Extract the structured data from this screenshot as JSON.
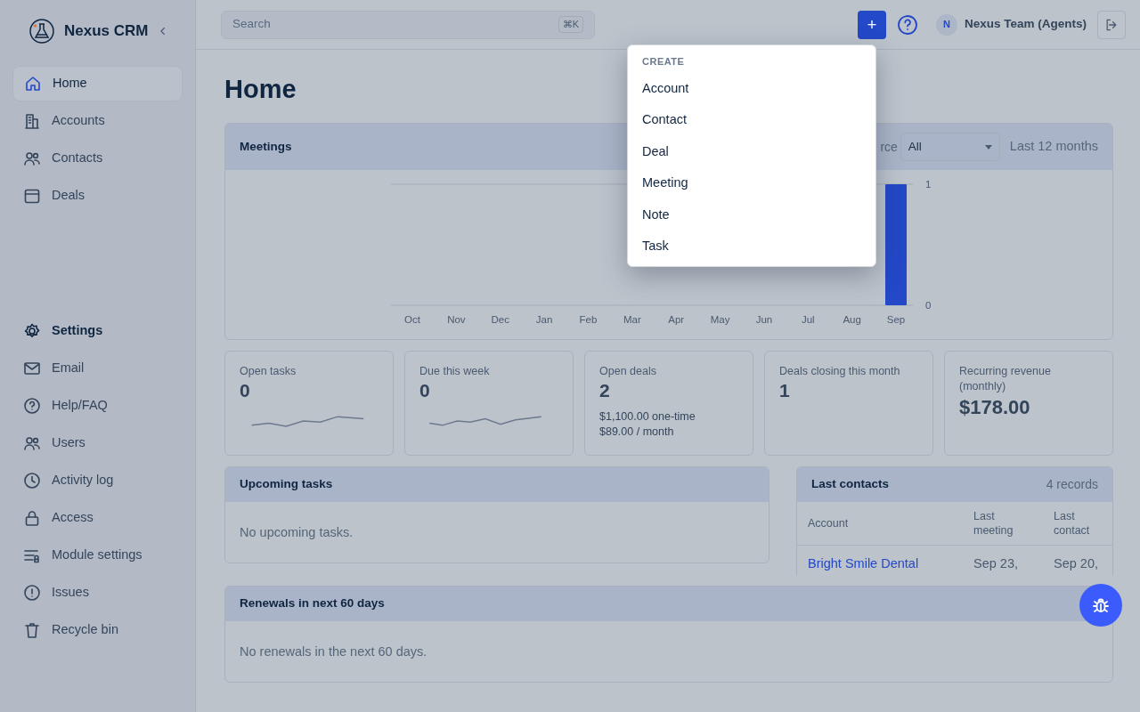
{
  "brand": {
    "name": "Nexus CRM"
  },
  "sidebar": {
    "items": [
      {
        "label": "Home",
        "selected": true
      },
      {
        "label": "Accounts",
        "selected": false
      },
      {
        "label": "Contacts",
        "selected": false
      },
      {
        "label": "Deals",
        "selected": false
      }
    ],
    "settings": {
      "label": "Settings",
      "items": [
        {
          "label": "Email",
          "selected": false
        },
        {
          "label": "Help/FAQ",
          "selected": false
        },
        {
          "label": "Users",
          "selected": false
        },
        {
          "label": "Activity log",
          "selected": false
        },
        {
          "label": "Access",
          "selected": false
        },
        {
          "label": "Module settings",
          "selected": false
        },
        {
          "label": "Issues",
          "selected": false
        },
        {
          "label": "Recycle bin",
          "selected": false
        }
      ]
    }
  },
  "topbar": {
    "search": {
      "placeholder": "Search",
      "shortcut": "⌘K"
    },
    "add_button": "+",
    "user": {
      "initial": "N",
      "name": "Nexus Team (Agents)"
    }
  },
  "create_menu": {
    "header": "CREATE",
    "items": [
      "Account",
      "Contact",
      "Deal",
      "Meeting",
      "Note",
      "Task"
    ]
  },
  "page_title": "Home",
  "meetings": {
    "title": "Meetings",
    "filter_label": "rce",
    "filter_value": "All",
    "range": "Last 12 months",
    "chart_data": {
      "type": "bar",
      "categories": [
        "Oct",
        "Nov",
        "Dec",
        "Jan",
        "Feb",
        "Mar",
        "Apr",
        "May",
        "Jun",
        "Jul",
        "Aug",
        "Sep"
      ],
      "series": [
        {
          "color": "#2348c8",
          "values": [
            0,
            0,
            0,
            0,
            0,
            0,
            0,
            0,
            0,
            0,
            0,
            1
          ]
        }
      ],
      "ylim": [
        0,
        1
      ],
      "yticks": [
        0,
        1
      ]
    }
  },
  "stats": [
    {
      "label": "Open tasks",
      "value": "0",
      "kind": "sparkline"
    },
    {
      "label": "Due this week",
      "value": "0",
      "kind": "sparkline"
    },
    {
      "label": "Open deals",
      "value": "2",
      "kind": "lines",
      "lines": [
        "$1,100.00 one-time",
        "$89.00 / month"
      ]
    },
    {
      "label": "Deals closing this month",
      "value": "1",
      "kind": "plain"
    },
    {
      "label": "Recurring revenue (monthly)",
      "value": "$178.00",
      "kind": "large"
    }
  ],
  "upcoming_tasks": {
    "title": "Upcoming tasks",
    "empty": "No upcoming tasks."
  },
  "last_contacts": {
    "title": "Last contacts",
    "count": "4 records",
    "columns": [
      "Account",
      "Last meeting",
      "Last contact"
    ],
    "rows": [
      {
        "account": "Bright Smile Dental",
        "last_meeting": "Sep 23,",
        "last_contact": "Sep 20,"
      }
    ]
  },
  "renewals": {
    "title": "Renewals in next 60 days",
    "empty": "No renewals in the next 60 days."
  }
}
